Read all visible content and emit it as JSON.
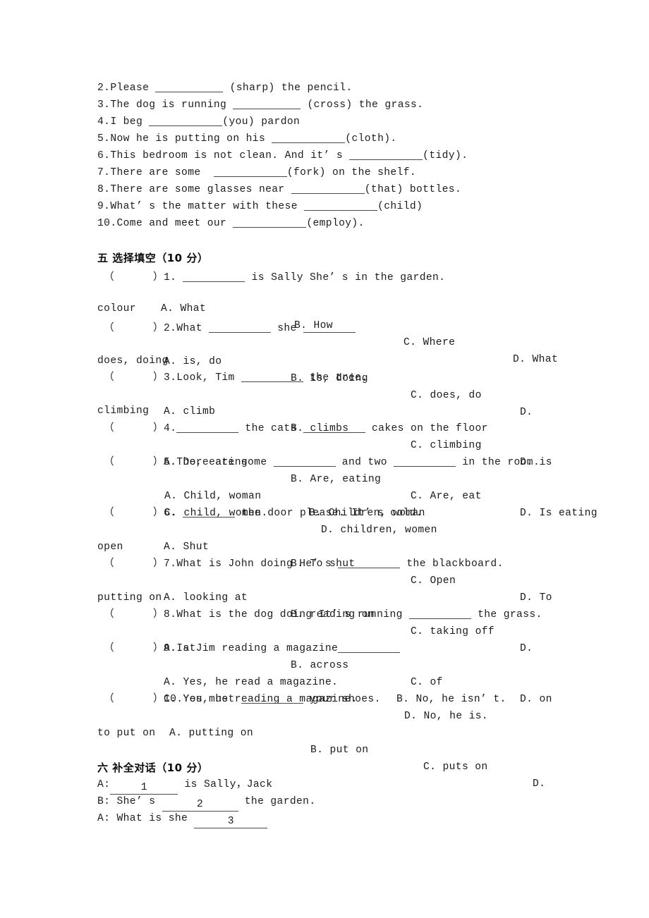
{
  "document": {
    "type": "english-exam-worksheet",
    "language": "zh-CN + en"
  },
  "fill_in_section": {
    "items": [
      {
        "num": "2.",
        "pre": "Please ",
        "post": " (sharp) the pencil."
      },
      {
        "num": "3.",
        "pre": "The dog is running ",
        "post": " (cross) the grass."
      },
      {
        "num": "4.",
        "pre": "I beg ",
        "post": "(you) pardon"
      },
      {
        "num": "5.",
        "pre": "Now he is putting on his ",
        "post": "(cloth)."
      },
      {
        "num": "6.",
        "pre": "This bedroom is not clean. And it’ s ",
        "post": "(tidy)."
      },
      {
        "num": "7.",
        "pre": "There are some  ",
        "post": "(fork) on the shelf."
      },
      {
        "num": "8.",
        "pre": "There are some glasses near ",
        "post": "(that) bottles."
      },
      {
        "num": "9.",
        "pre": "What’ s the matter with these ",
        "post": "(child)"
      },
      {
        "num": "10.",
        "pre": "Come and meet our ",
        "post": "(employ)."
      }
    ]
  },
  "choice_section": {
    "heading": "五 选择填空（10 分）",
    "bracket_open": "（",
    "bracket_close": "）",
    "questions": [
      {
        "num": "1.",
        "stem_pre": " ",
        "stem_post": " is Sally She’ s in the garden.",
        "options": [
          "A. What",
          "B. How",
          "C. Where",
          "D. What"
        ],
        "overflow": "colour"
      },
      {
        "num": "2.",
        "stem_pre": "What ",
        "stem_mid": " she ",
        "stem_post": "",
        "options": [
          "A. is, do",
          "B. is, doing",
          "C. does, do",
          "D."
        ],
        "overflow": "does, doing"
      },
      {
        "num": "3.",
        "stem_pre": "Look, Tim ",
        "stem_post": " the tree.",
        "options": [
          "A. climb",
          "B. climbs",
          "C. climbing",
          "D. is"
        ],
        "overflow": "climbing"
      },
      {
        "num": "4.",
        "stem_pre": "",
        "stem_mid": " the cats ",
        "stem_post": " cakes on the floor",
        "options": [
          "A. Do, eating",
          "B. Are, eating",
          "C. Are, eat",
          "D. Is eating"
        ],
        "overflow": ""
      },
      {
        "num": "5.",
        "stem_pre": "There are some ",
        "stem_mid": " and two ",
        "stem_post": " in the room.",
        "options": [
          "A. Child, woman",
          "B. Children, woman",
          "C. child, women.",
          "D. children, women"
        ],
        "overflow": ""
      },
      {
        "num": "6.",
        "stem_pre": " ",
        "stem_post": " the door please. It’ s cold.",
        "options": [
          "A. Shut",
          "B. To shut",
          "C. Open",
          "D. To"
        ],
        "overflow": "open"
      },
      {
        "num": "7.",
        "stem_pre": "What is John doing He’ s ",
        "stem_post": " the blackboard.",
        "options": [
          "A. looking at",
          "B. reading on",
          "C. taking off",
          "D."
        ],
        "overflow": "putting on"
      },
      {
        "num": "8.",
        "stem_pre": "What is the dog doing It’ s running ",
        "stem_post": " the grass.",
        "options": [
          "A. at",
          "B. across",
          "C. of",
          "D. on"
        ],
        "overflow": ""
      },
      {
        "num": "9.",
        "stem_pre": "Is Jim reading a magazine",
        "stem_post": "",
        "options": [
          "A. Yes, he read a magazine.",
          "B. No, he isn’ t.",
          "C. Yes, he reading a magazine.",
          "D. No, he is."
        ],
        "overflow": ""
      },
      {
        "num": "10.",
        "stem_pre": "You must ",
        "stem_post": " your shoes.",
        "options": [
          "A. putting on",
          "B. put on",
          "C. puts on",
          "D."
        ],
        "overflow": "to put on"
      }
    ]
  },
  "dialogue_section": {
    "heading": "六 补全对话（10 分）",
    "lines": [
      {
        "speaker": "A:",
        "pre": "",
        "blank": "1",
        "post": " is Sally，Jack"
      },
      {
        "speaker": "B:",
        "pre": " She’ s ",
        "blank": "2",
        "post": " the garden."
      },
      {
        "speaker": "A:",
        "pre": " What is she ",
        "blank": "3",
        "post": ""
      }
    ]
  }
}
